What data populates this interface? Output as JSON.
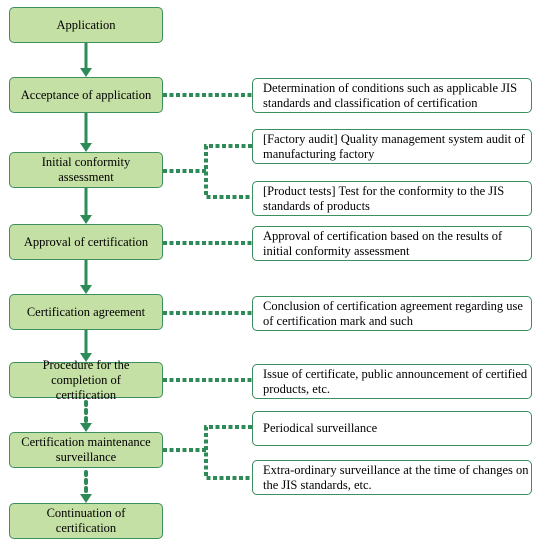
{
  "steps": [
    "Application",
    "Acceptance of application",
    "Initial conformity assessment",
    "Approval of certification",
    "Certification agreement",
    "Procedure for the completion of certification",
    "Certification maintenance surveillance",
    "Continuation of certification"
  ],
  "details": [
    "Determination of conditions such as applicable JIS standards and classification of certification",
    "[Factory audit] Quality management system audit of manufacturing factory",
    "[Product tests] Test for the conformity to the JIS standards of products",
    "Approval of certification based on the results of initial conformity assessment",
    "Conclusion of  certification agreement regarding use of certification mark and such",
    "Issue of certificate, public announcement of certified products, etc.",
    "Periodical surveillance",
    "Extra-ordinary surveillance at the time of changes on the JIS standards, etc."
  ],
  "colors": {
    "box_fill": "#c5e0a5",
    "line": "#2e8b57"
  }
}
